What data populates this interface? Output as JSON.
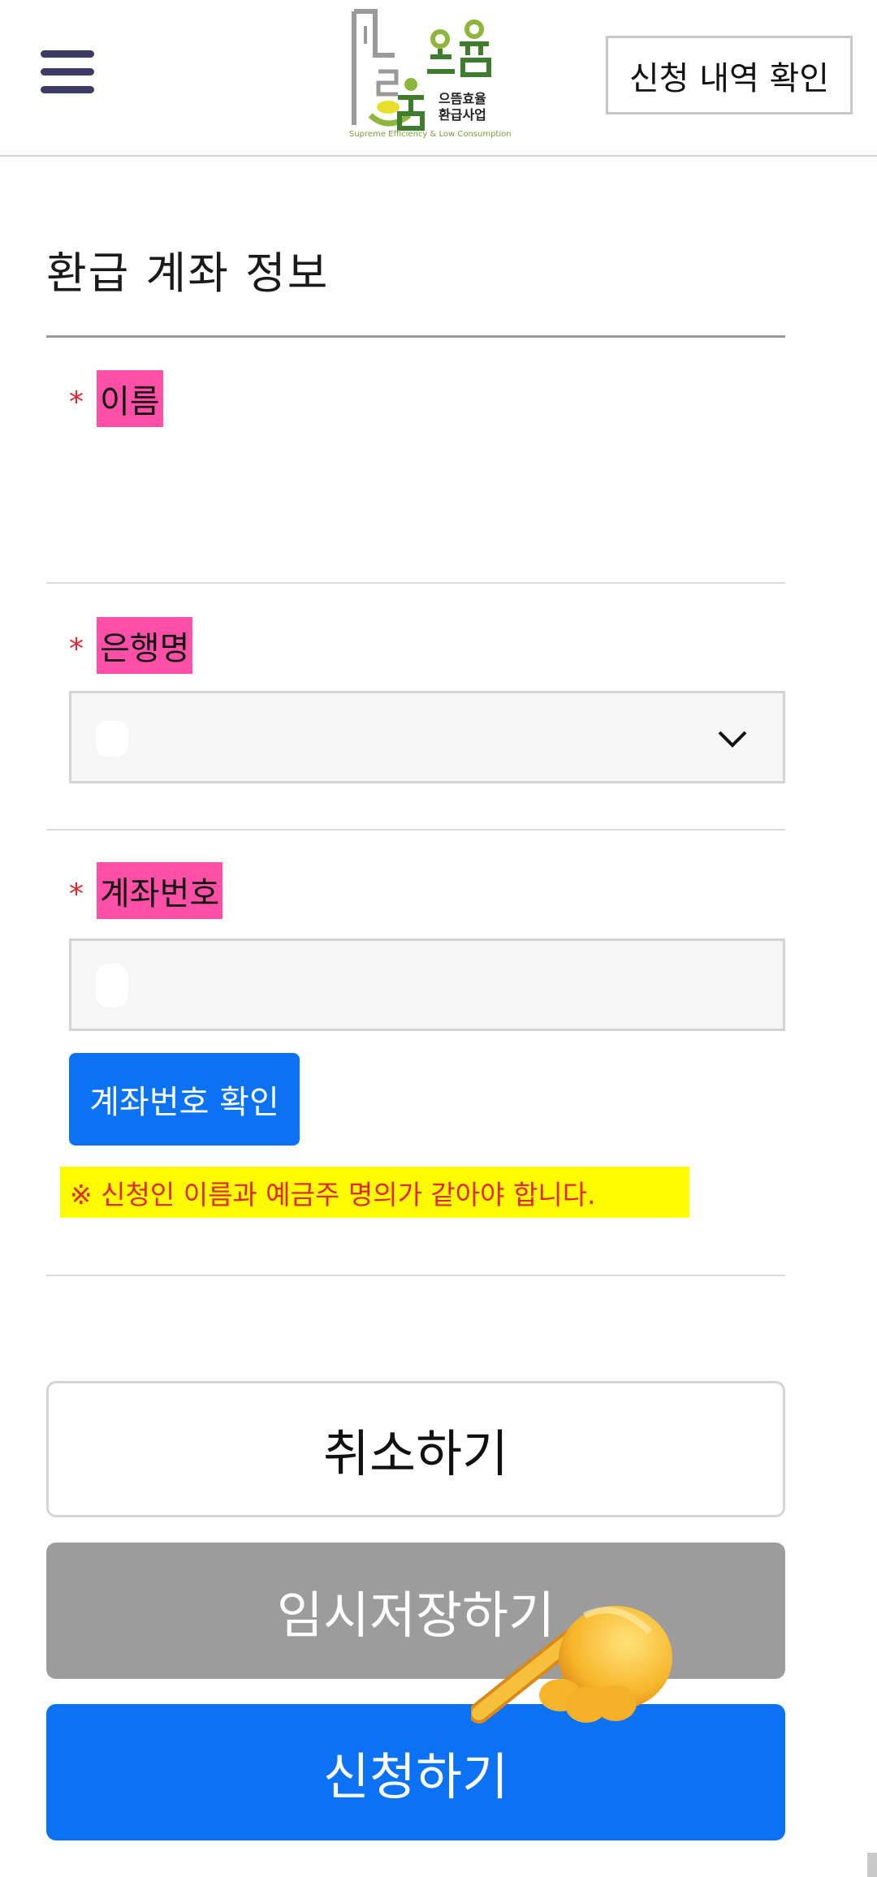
{
  "header": {
    "menu_icon": "hamburger-menu-icon",
    "logo": {
      "name_line1": "으뜸효율",
      "name_line2": "환급사업",
      "subtitle": "Supreme Efficiency & Low Consumption",
      "colors": {
        "green": "#8db63c",
        "dark_green": "#3f7d2e",
        "yellow": "#e8df2a",
        "gray": "#9a9a9a"
      }
    },
    "history_button": "신청 내역 확인"
  },
  "section": {
    "title": "환급 계좌 정보"
  },
  "fields": {
    "name": {
      "required_mark": "*",
      "label": "이름"
    },
    "bank": {
      "required_mark": "*",
      "label": "은행명",
      "dropdown_icon": "chevron-down-icon"
    },
    "account": {
      "required_mark": "*",
      "label": "계좌번호",
      "verify_button": "계좌번호 확인"
    }
  },
  "notice": "※ 신청인 이름과 예금주 명의가 같아야 합니다.",
  "actions": {
    "cancel": "취소하기",
    "temp_save": "임시저장하기",
    "submit": "신청하기"
  },
  "overlay": {
    "pointer_icon": "pointing-hand-emoji-icon"
  },
  "colors": {
    "primary": "#0b72f5",
    "disabled": "#9c9c9c",
    "required": "#e0282f",
    "label_highlight": "#ff4fa6",
    "notice_highlight": "#fffb00"
  }
}
